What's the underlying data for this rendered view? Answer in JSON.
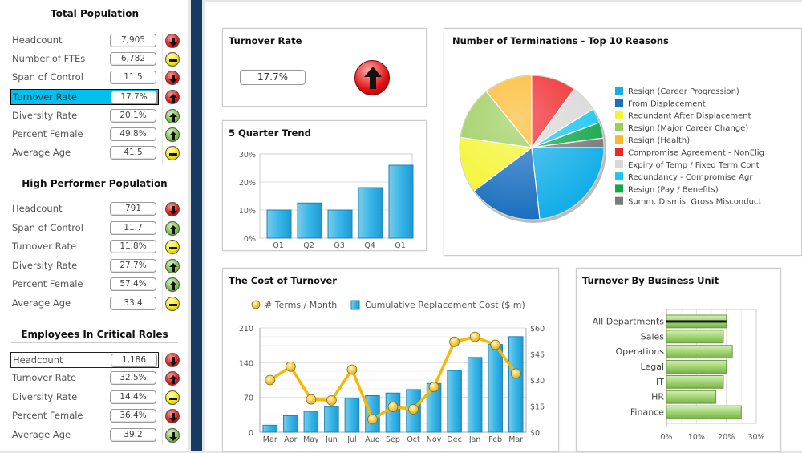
{
  "sidebar": {
    "sections": [
      {
        "title": "Total Population",
        "rows": [
          {
            "label": "Headcount",
            "value": "7,905",
            "indicator": "down-red"
          },
          {
            "label": "Number of FTEs",
            "value": "6,782",
            "indicator": "neutral-yellow"
          },
          {
            "label": "Span of Control",
            "value": "11.5",
            "indicator": "down-red"
          },
          {
            "label": "Turnover Rate",
            "value": "17.7%",
            "indicator": "up-red",
            "selected": true
          },
          {
            "label": "Diversity Rate",
            "value": "20.1%",
            "indicator": "up-green"
          },
          {
            "label": "Percent Female",
            "value": "49.8%",
            "indicator": "up-green"
          },
          {
            "label": "Average Age",
            "value": "41.5",
            "indicator": "neutral-yellow"
          }
        ]
      },
      {
        "title": "High Performer Population",
        "rows": [
          {
            "label": "Headcount",
            "value": "791",
            "indicator": "down-red"
          },
          {
            "label": "Span of Control",
            "value": "11.7",
            "indicator": "up-green"
          },
          {
            "label": "Turnover Rate",
            "value": "11.8%",
            "indicator": "neutral-yellow"
          },
          {
            "label": "Diversity Rate",
            "value": "27.7%",
            "indicator": "up-green"
          },
          {
            "label": "Percent Female",
            "value": "57.4%",
            "indicator": "up-green"
          },
          {
            "label": "Average Age",
            "value": "33.4",
            "indicator": "neutral-yellow"
          }
        ]
      },
      {
        "title": "Employees In Critical Roles",
        "rows": [
          {
            "label": "Headcount",
            "value": "1,186",
            "indicator": "down-red",
            "focused": true
          },
          {
            "label": "Turnover Rate",
            "value": "32.5%",
            "indicator": "up-red"
          },
          {
            "label": "Diversity Rate",
            "value": "14.4%",
            "indicator": "neutral-yellow"
          },
          {
            "label": "Percent Female",
            "value": "36.4%",
            "indicator": "down-red"
          },
          {
            "label": "Average Age",
            "value": "39.2",
            "indicator": "down-green"
          }
        ]
      }
    ]
  },
  "turnover_panel": {
    "title": "Turnover Rate",
    "value": "17.7%",
    "indicator": "up-red"
  },
  "chart_data": [
    {
      "id": "quarter",
      "type": "bar",
      "title": "5 Quarter Trend",
      "categories": [
        "Q1",
        "Q2",
        "Q3",
        "Q4",
        "Q1"
      ],
      "values": [
        10,
        12.5,
        10,
        18,
        26
      ],
      "ylim": [
        0,
        30
      ],
      "yticks": [
        "0%",
        "10%",
        "20%",
        "30%"
      ],
      "grid": true,
      "color": "#2fb2e4"
    },
    {
      "id": "pie",
      "type": "pie",
      "title": "Number of Terminations - Top 10 Reasons",
      "legend_position": "right",
      "slices": [
        {
          "label": "Resign (Career Progression)",
          "value": 23.2,
          "color": "#12aee8"
        },
        {
          "label": "From Displacement",
          "value": 16.5,
          "color": "#1a6fbf"
        },
        {
          "label": "Redundant After Displacement",
          "value": 12.5,
          "color": "#f4f430"
        },
        {
          "label": "Resign (Major Career Change)",
          "value": 11.9,
          "color": "#9acd5a"
        },
        {
          "label": "Resign (Health)",
          "value": 10.8,
          "color": "#fbb829"
        },
        {
          "label": "Compromise Agreement - NonElig",
          "value": 10.0,
          "color": "#f0262a"
        },
        {
          "label": "Expiry of Temp / Fixed Term Cont",
          "value": 6.1,
          "color": "#d8d8d8"
        },
        {
          "label": "Redundancy - Compromise Agr",
          "value": 3.3,
          "color": "#1cc6f3"
        },
        {
          "label": "Resign (Pay / Benefits)",
          "value": 3.5,
          "color": "#12a84a"
        },
        {
          "label": "Summ. Dismis. Gross Misconduct",
          "value": 2.1,
          "color": "#7a7a7a"
        }
      ]
    },
    {
      "id": "cost",
      "type": "bar+line",
      "title": "The Cost of Turnover",
      "legend_position": "top",
      "categories": [
        "Mar",
        "Apr",
        "May",
        "Jun",
        "Jul",
        "Aug",
        "Sep",
        "Oct",
        "Nov",
        "Dec",
        "Jan",
        "Feb",
        "Mar"
      ],
      "series": [
        {
          "name": "# Terms / Month",
          "type": "line",
          "axis": "left",
          "values": [
            105,
            132,
            66,
            64,
            126,
            26,
            51,
            46,
            91,
            182,
            192,
            176,
            118
          ],
          "color": "#f7b800"
        },
        {
          "name": "Cumulative Replacement Cost ($ m)",
          "type": "bar",
          "axis": "right",
          "values": [
            4,
            9.5,
            12,
            14.5,
            19.5,
            21,
            22.5,
            24.5,
            28,
            35.5,
            43,
            50.5,
            55
          ],
          "color": "#2fb2e4"
        }
      ],
      "ylim_left": [
        0,
        210
      ],
      "yticks_left": [
        "0",
        "70",
        "140",
        "210"
      ],
      "ylim_right": [
        0,
        60
      ],
      "yticks_right": [
        "$0",
        "$15",
        "$30",
        "$45",
        "$60"
      ],
      "grid": true
    },
    {
      "id": "bu",
      "type": "hbar",
      "title": "Turnover By Business Unit",
      "categories": [
        "All Departments",
        "Sales",
        "Operations",
        "Legal",
        "IT",
        "HR",
        "Finance"
      ],
      "values": [
        20,
        19,
        22,
        20,
        19,
        16.5,
        25
      ],
      "xlim": [
        0,
        30
      ],
      "xticks": [
        "0%",
        "10%",
        "20%",
        "30%"
      ],
      "color": "#9fd16a"
    }
  ]
}
